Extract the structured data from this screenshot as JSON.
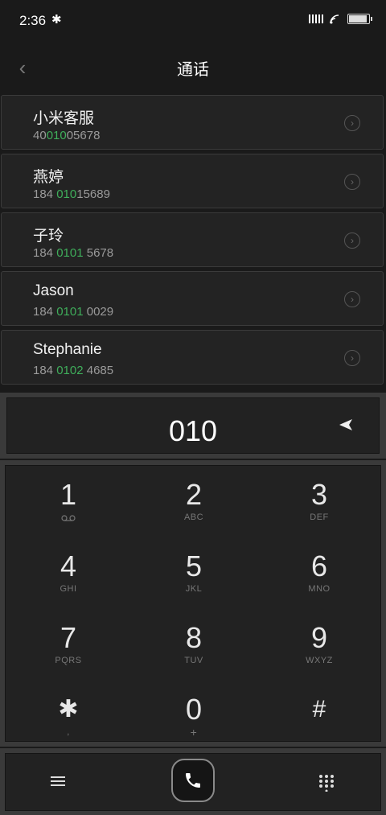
{
  "status_bar": {
    "time": "2:36",
    "bt_icon": "bluetooth-icon"
  },
  "header": {
    "title": "通话"
  },
  "contacts": [
    {
      "name": "小米客服",
      "number_pre": "40",
      "number_match": "010",
      "number_post": "05678"
    },
    {
      "name": "燕婷",
      "number_pre": "184 ",
      "number_match": "010",
      "number_post": "15689"
    },
    {
      "name": "子玲",
      "number_pre": "184 ",
      "number_match": "0101",
      "number_post": " 5678"
    },
    {
      "name": "Jason",
      "number_pre": "184 ",
      "number_match": "0101",
      "number_post": " 0029"
    },
    {
      "name": "Stephanie",
      "number_pre": "184 ",
      "number_match": "0102",
      "number_post": " 4685"
    }
  ],
  "dial_input": "010",
  "keypad": [
    {
      "digit": "1",
      "sub": "voicemail-icon"
    },
    {
      "digit": "2",
      "sub": "ABC"
    },
    {
      "digit": "3",
      "sub": "DEF"
    },
    {
      "digit": "4",
      "sub": "GHI"
    },
    {
      "digit": "5",
      "sub": "JKL"
    },
    {
      "digit": "6",
      "sub": "MNO"
    },
    {
      "digit": "7",
      "sub": "PQRS"
    },
    {
      "digit": "8",
      "sub": "TUV"
    },
    {
      "digit": "9",
      "sub": "WXYZ"
    },
    {
      "digit": "✱",
      "sub": ","
    },
    {
      "digit": "0",
      "sub": "+"
    },
    {
      "digit": "#",
      "sub": ""
    }
  ],
  "colors": {
    "match": "#3fae5b",
    "background": "#1a1a1a"
  }
}
